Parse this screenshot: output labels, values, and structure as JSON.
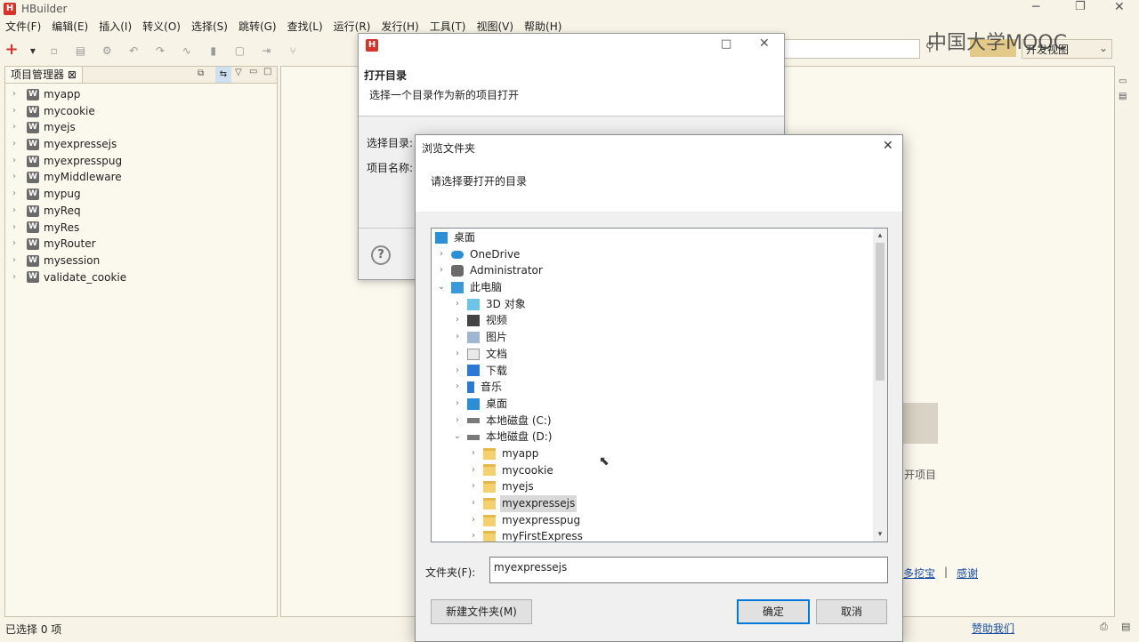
{
  "app": {
    "title": "HBuilder",
    "watermark": "中国大学MOOC",
    "view_select": "开发视图"
  },
  "menu": [
    "文件(F)",
    "编辑(E)",
    "插入(I)",
    "转义(O)",
    "选择(S)",
    "跳转(G)",
    "查找(L)",
    "运行(R)",
    "发行(H)",
    "工具(T)",
    "视图(V)",
    "帮助(H)"
  ],
  "project_panel": {
    "tab_label": "项目管理器 ⊠",
    "projects": [
      "myapp",
      "mycookie",
      "myejs",
      "myexpressejs",
      "myexpresspug",
      "myMiddleware",
      "mypug",
      "myReq",
      "myRes",
      "myRouter",
      "mysession",
      "validate_cookie"
    ]
  },
  "editor_bg": {
    "open_project_label": "开项目",
    "links": [
      "多挖宝",
      "感谢"
    ]
  },
  "status": {
    "left": "已选择 0 项",
    "donate": "赞助我们"
  },
  "open_dir_dialog": {
    "heading": "打开目录",
    "desc": "选择一个目录作为新的项目打开",
    "select_dir_label": "选择目录:",
    "project_name_label": "项目名称:"
  },
  "browse_dialog": {
    "title": "浏览文件夹",
    "prompt": "请选择要打开的目录",
    "tree": [
      {
        "label": "桌面",
        "level": 0,
        "chev": "",
        "icon": "desktop"
      },
      {
        "label": "OneDrive",
        "level": 1,
        "chev": "›",
        "icon": "cloud"
      },
      {
        "label": "Administrator",
        "level": 1,
        "chev": "›",
        "icon": "user"
      },
      {
        "label": "此电脑",
        "level": 1,
        "chev": "⌄",
        "icon": "pc"
      },
      {
        "label": "3D 对象",
        "level": 2,
        "chev": "›",
        "icon": "cube"
      },
      {
        "label": "视频",
        "level": 2,
        "chev": "›",
        "icon": "video"
      },
      {
        "label": "图片",
        "level": 2,
        "chev": "›",
        "icon": "picture"
      },
      {
        "label": "文档",
        "level": 2,
        "chev": "›",
        "icon": "doc"
      },
      {
        "label": "下载",
        "level": 2,
        "chev": "›",
        "icon": "download"
      },
      {
        "label": "音乐",
        "level": 2,
        "chev": "›",
        "icon": "music"
      },
      {
        "label": "桌面",
        "level": 2,
        "chev": "›",
        "icon": "desktop"
      },
      {
        "label": "本地磁盘 (C:)",
        "level": 2,
        "chev": "›",
        "icon": "drive"
      },
      {
        "label": "本地磁盘 (D:)",
        "level": 2,
        "chev": "⌄",
        "icon": "drive"
      },
      {
        "label": "myapp",
        "level": 3,
        "chev": "›",
        "icon": "folder"
      },
      {
        "label": "mycookie",
        "level": 3,
        "chev": "›",
        "icon": "folder"
      },
      {
        "label": "myejs",
        "level": 3,
        "chev": "›",
        "icon": "folder"
      },
      {
        "label": "myexpressejs",
        "level": 3,
        "chev": "›",
        "icon": "folder",
        "selected": true
      },
      {
        "label": "myexpresspug",
        "level": 3,
        "chev": "›",
        "icon": "folder"
      },
      {
        "label": "myFirstExpress",
        "level": 3,
        "chev": "›",
        "icon": "folder"
      }
    ],
    "folder_label": "文件夹(F):",
    "folder_value": "myexpressejs",
    "new_folder_btn": "新建文件夹(M)",
    "ok_btn": "确定",
    "cancel_btn": "取消"
  }
}
